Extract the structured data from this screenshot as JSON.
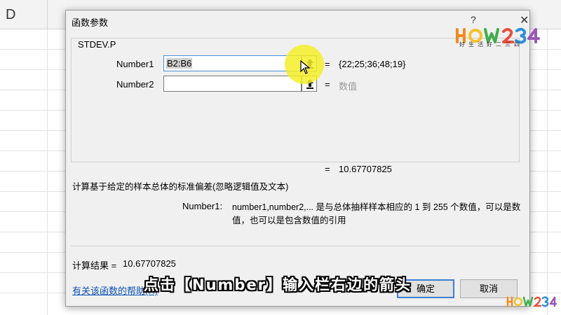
{
  "sheet": {
    "column_letter": "D"
  },
  "dialog": {
    "title": "函数参数",
    "help_glyph": "?",
    "close_glyph": "✕",
    "function_name": "STDEV.P",
    "args": [
      {
        "label": "Number1",
        "value": "B2:B6",
        "eq": "=",
        "result": "{22;25;36;48;19}"
      },
      {
        "label": "Number2",
        "value": "",
        "eq": "=",
        "result": "数值"
      }
    ],
    "result_eq": "=",
    "result_value": "10.67707825",
    "description": "计算基于给定的样本总体的标准偏差(忽略逻辑值及文本)",
    "arg_help_label": "Number1:",
    "arg_help_text": "number1,number2,... 是与总体抽样样本相应的 1 到 255 个数值，可以是数值，也可以是包含数值的引用",
    "calc_label": "计算结果 =",
    "calc_value": "10.67707825",
    "help_link": "有关该函数的帮助(H)",
    "ok_label": "确定",
    "cancel_label": "取消"
  },
  "watermark": {
    "text": "HOW234",
    "sub": "好生活好二三四",
    "small": "HOW234"
  },
  "caption": "点击【Number】输入栏右边的箭头",
  "colors": {
    "highlight": "#f4ee28",
    "link": "#0b4fb3",
    "ok_border": "#3c7fd1"
  }
}
